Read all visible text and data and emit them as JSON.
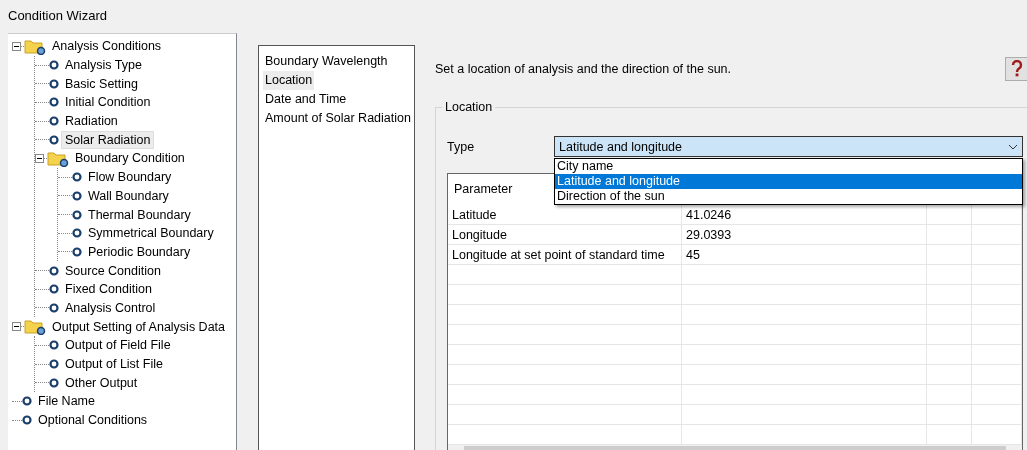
{
  "window": {
    "title": "Condition Wizard"
  },
  "tree": [
    {
      "label": "Analysis Conditions",
      "expanded": true,
      "selected": false,
      "children": [
        {
          "label": "Analysis Type",
          "selected": false
        },
        {
          "label": "Basic Setting",
          "selected": false
        },
        {
          "label": "Initial Condition",
          "selected": false
        },
        {
          "label": "Radiation",
          "selected": false
        },
        {
          "label": "Solar Radiation",
          "selected": true
        },
        {
          "label": "Boundary Condition",
          "expanded": true,
          "selected": false,
          "children": [
            {
              "label": "Flow Boundary",
              "selected": false
            },
            {
              "label": "Wall Boundary",
              "selected": false
            },
            {
              "label": "Thermal Boundary",
              "selected": false
            },
            {
              "label": "Symmetrical Boundary",
              "selected": false
            },
            {
              "label": "Periodic Boundary",
              "selected": false
            }
          ]
        },
        {
          "label": "Source Condition",
          "selected": false
        },
        {
          "label": "Fixed Condition",
          "selected": false
        },
        {
          "label": "Analysis Control",
          "selected": false
        }
      ]
    },
    {
      "label": "Output Setting of Analysis Data",
      "expanded": true,
      "selected": false,
      "children": [
        {
          "label": "Output of Field File",
          "selected": false
        },
        {
          "label": "Output of List File",
          "selected": false
        },
        {
          "label": "Other Output",
          "selected": false
        }
      ]
    },
    {
      "label": "File Name",
      "selected": false
    },
    {
      "label": "Optional Conditions",
      "selected": false
    }
  ],
  "pages": [
    {
      "label": "Boundary Wavelength",
      "selected": false
    },
    {
      "label": "Location",
      "selected": true
    },
    {
      "label": "Date and Time",
      "selected": false
    },
    {
      "label": "Amount of Solar Radiation",
      "selected": false
    }
  ],
  "description": "Set a location of analysis and the direction of the sun.",
  "group": {
    "title": "Location",
    "type_label": "Type",
    "type_value": "Latitude and longitude",
    "dropdown_open": true,
    "options": [
      {
        "label": "City name",
        "selected": false
      },
      {
        "label": "Latitude and longitude",
        "selected": true
      },
      {
        "label": "Direction of the sun",
        "selected": false
      }
    ]
  },
  "table": {
    "columns": [
      "Parameter"
    ],
    "rows": [
      [
        "Latitude",
        "41.0246"
      ],
      [
        "Longitude",
        "29.0393"
      ],
      [
        "Longitude at set point of standard time",
        "45"
      ]
    ]
  }
}
